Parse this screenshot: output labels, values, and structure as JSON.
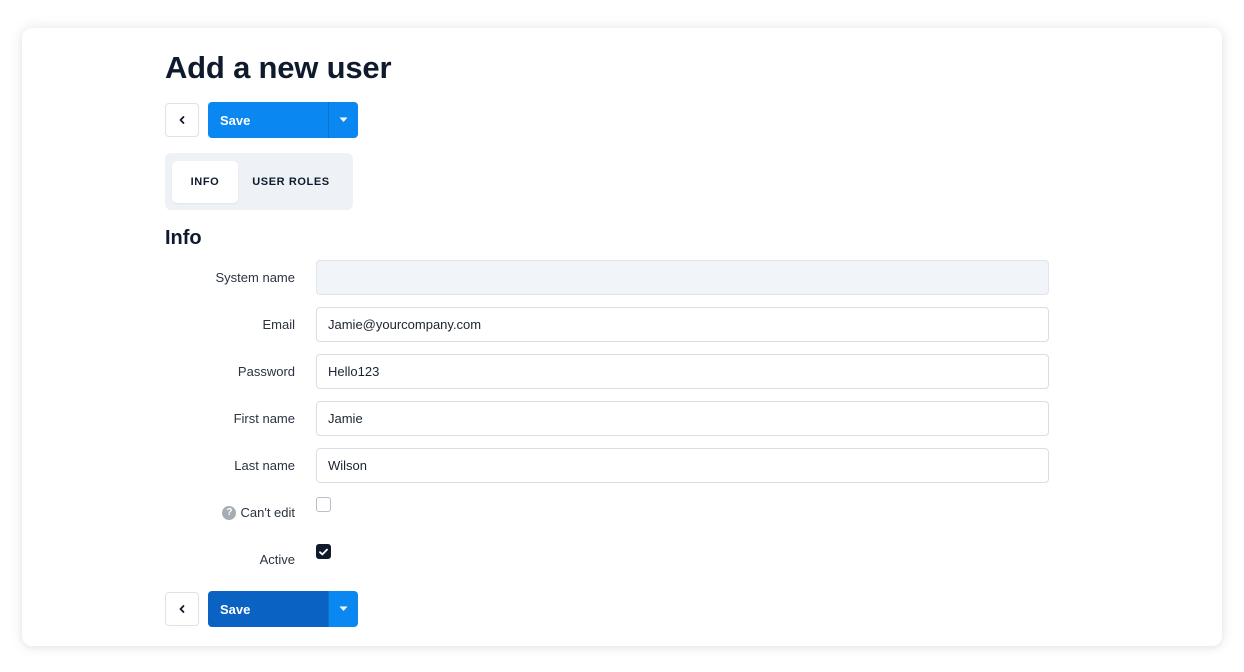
{
  "page": {
    "title": "Add a new user"
  },
  "toolbar": {
    "back_icon": "chevron-left-icon",
    "save_label": "Save",
    "save_menu_icon": "caret-down-icon"
  },
  "tabs": [
    {
      "label": "INFO",
      "active": true
    },
    {
      "label": "USER ROLES",
      "active": false
    }
  ],
  "section": {
    "title": "Info"
  },
  "form": {
    "system_name": {
      "label": "System name",
      "value": "",
      "disabled": true
    },
    "email": {
      "label": "Email",
      "value": "Jamie@yourcompany.com"
    },
    "password": {
      "label": "Password",
      "value": "Hello123"
    },
    "first_name": {
      "label": "First name",
      "value": "Jamie"
    },
    "last_name": {
      "label": "Last name",
      "value": "Wilson"
    },
    "cant_edit": {
      "label": "Can't edit",
      "checked": false,
      "help_icon": "question-circle-icon"
    },
    "active": {
      "label": "Active",
      "checked": true
    }
  },
  "colors": {
    "primary": "#0b87f2",
    "primary_dark": "#0a63c2",
    "text": "#0f1b2d",
    "tab_bg": "#eef2f7",
    "disabled_input_bg": "#f1f4f8"
  }
}
